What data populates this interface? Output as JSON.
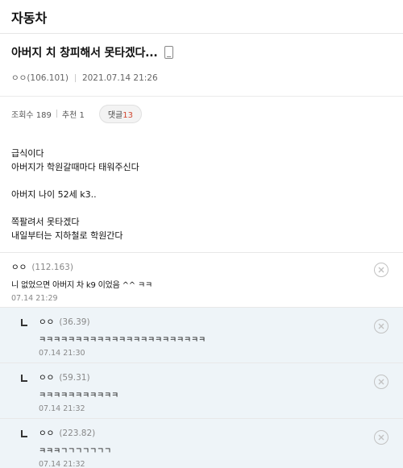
{
  "board": {
    "title": "자동차"
  },
  "post": {
    "title": "아버지 치 창피해서 못타겠다...",
    "author": "ㅇㅇ(106.101)",
    "date": "2021.07.14 21:26",
    "views_label": "조회수 189",
    "recommend_label": "추천 1",
    "comments_label": "댓글",
    "comments_count": "13",
    "body": [
      "급식이다",
      "아버지가 학원갈때마다 태워주신다",
      "",
      "아버지 나이 52세 k3..",
      "",
      "쪽팔려서 못타겠다",
      "내일부터는 지하철로 학원간다"
    ]
  },
  "comments": [
    {
      "author": "ㅇㅇ",
      "score": "(112.163)",
      "text": "니 없었으면 아버지 차 k9 이었음 ^^ ㅋㅋ",
      "date": "07.14 21:29"
    },
    {
      "author": "ㅇㅇ",
      "score": "(36.39)",
      "text": "ㅋㅋㅋㅋㅋㅋㅋㅋㅋㅋㅋㅋㅋㅋㅋㅋㅋㅋㅋㅋㅋㅋㅋ",
      "date": "07.14 21:30"
    },
    {
      "author": "ㅇㅇ",
      "score": "(59.31)",
      "text": "ㅋㅋㅋㅋㅋㅋㅋㅋㅋㅋㅋ",
      "date": "07.14 21:32"
    },
    {
      "author": "ㅇㅇ",
      "score": "(223.82)",
      "text": "ㅋㅋㅋㄱㄱㄱㄱㄱㄱㄱ",
      "date": "07.14 21:32"
    }
  ]
}
